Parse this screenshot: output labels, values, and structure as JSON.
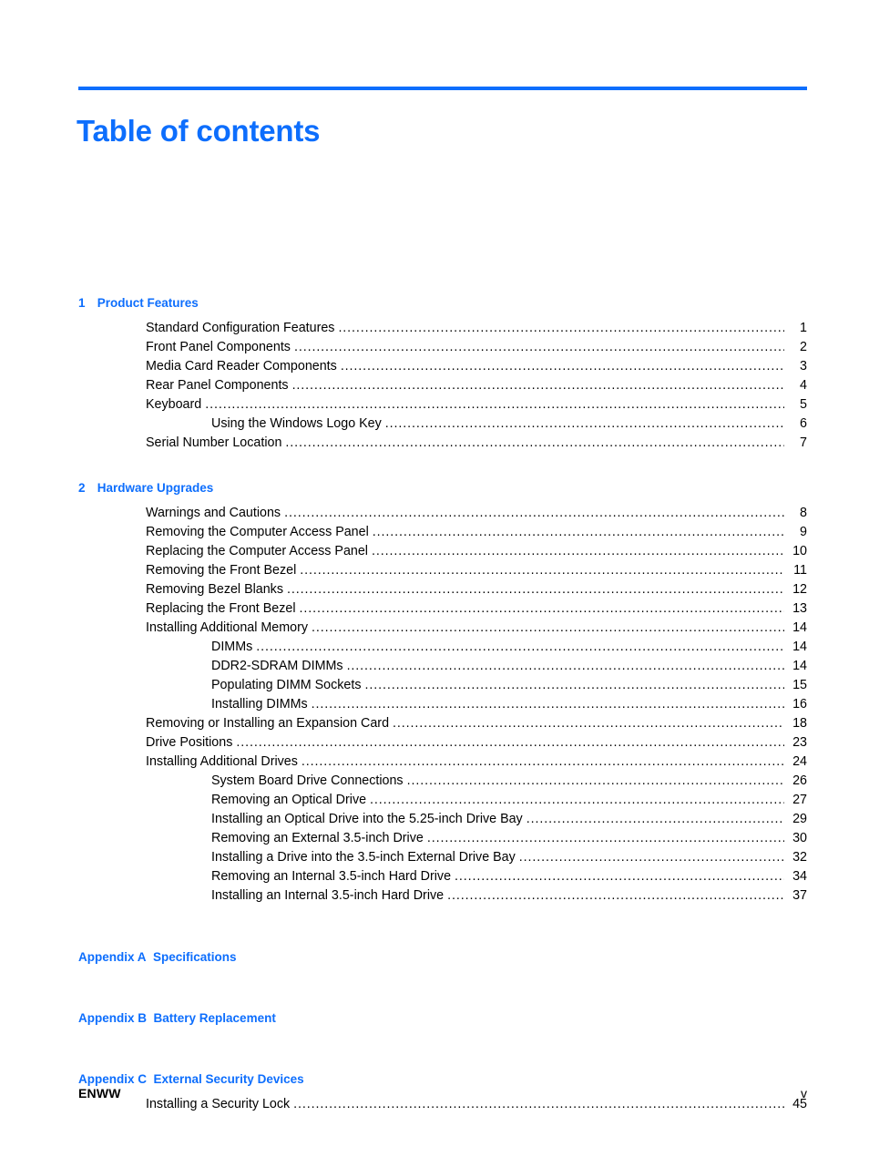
{
  "document": {
    "title": "Table of contents",
    "accent_color": "#0d6efd",
    "text_color": "#000000",
    "leader_char": "."
  },
  "footer": {
    "brand": "ENWW",
    "page_label": "v"
  },
  "toc": {
    "sections": [
      {
        "kind": "chapter",
        "number": "1",
        "title": "Product Features",
        "entries": [
          {
            "level": 1,
            "label": "Standard Configuration Features",
            "page": "1"
          },
          {
            "level": 1,
            "label": "Front Panel Components",
            "page": "2"
          },
          {
            "level": 1,
            "label": "Media Card Reader Components",
            "page": "3"
          },
          {
            "level": 1,
            "label": "Rear Panel Components",
            "page": "4"
          },
          {
            "level": 1,
            "label": "Keyboard",
            "page": "5"
          },
          {
            "level": 2,
            "label": "Using the Windows Logo Key",
            "page": "6"
          },
          {
            "level": 1,
            "label": "Serial Number Location",
            "page": "7"
          }
        ]
      },
      {
        "kind": "chapter",
        "number": "2",
        "title": "Hardware Upgrades",
        "entries": [
          {
            "level": 1,
            "label": "Warnings and Cautions",
            "page": "8"
          },
          {
            "level": 1,
            "label": "Removing the Computer Access Panel",
            "page": "9"
          },
          {
            "level": 1,
            "label": "Replacing the Computer Access Panel",
            "page": "10"
          },
          {
            "level": 1,
            "label": "Removing the Front Bezel",
            "page": "11"
          },
          {
            "level": 1,
            "label": "Removing Bezel Blanks",
            "page": "12"
          },
          {
            "level": 1,
            "label": "Replacing the Front Bezel",
            "page": "13"
          },
          {
            "level": 1,
            "label": "Installing Additional Memory",
            "page": "14"
          },
          {
            "level": 2,
            "label": "DIMMs",
            "page": "14"
          },
          {
            "level": 2,
            "label": "DDR2-SDRAM DIMMs",
            "page": "14"
          },
          {
            "level": 2,
            "label": "Populating DIMM Sockets",
            "page": "15"
          },
          {
            "level": 2,
            "label": "Installing DIMMs",
            "page": "16"
          },
          {
            "level": 1,
            "label": "Removing or Installing an Expansion Card",
            "page": "18"
          },
          {
            "level": 1,
            "label": "Drive Positions",
            "page": "23"
          },
          {
            "level": 1,
            "label": "Installing Additional Drives",
            "page": "24"
          },
          {
            "level": 2,
            "label": "System Board Drive Connections",
            "page": "26"
          },
          {
            "level": 2,
            "label": "Removing an Optical Drive",
            "page": "27"
          },
          {
            "level": 2,
            "label": "Installing an Optical Drive into the 5.25-inch Drive Bay",
            "page": "29"
          },
          {
            "level": 2,
            "label": "Removing an External 3.5-inch Drive",
            "page": "30"
          },
          {
            "level": 2,
            "label": "Installing a Drive into the 3.5-inch External Drive Bay",
            "page": "32"
          },
          {
            "level": 2,
            "label": "Removing an Internal 3.5-inch Hard Drive",
            "page": "34"
          },
          {
            "level": 2,
            "label": "Installing an Internal 3.5-inch Hard Drive",
            "page": "37"
          }
        ]
      },
      {
        "kind": "appendix",
        "number": "Appendix A",
        "title": "Specifications",
        "entries": []
      },
      {
        "kind": "appendix",
        "number": "Appendix B",
        "title": "Battery Replacement",
        "entries": []
      },
      {
        "kind": "appendix",
        "number": "Appendix C",
        "title": "External Security Devices",
        "entries": [
          {
            "level": 1,
            "label": "Installing a Security Lock",
            "page": "45"
          }
        ]
      }
    ]
  }
}
